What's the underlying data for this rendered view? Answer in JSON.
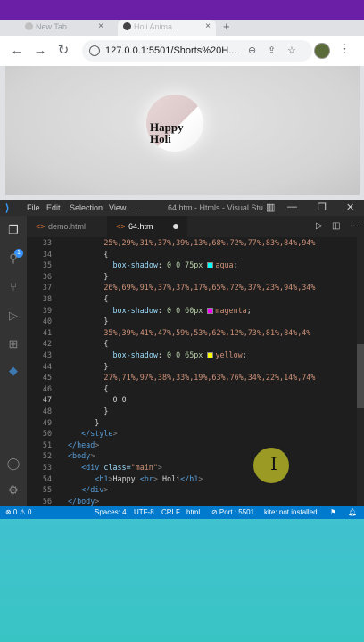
{
  "browser": {
    "tabs": [
      {
        "label": "New Tab"
      },
      {
        "label": "Holi Anima..."
      }
    ],
    "url": "127.0.0.1:5501/Shorts%20H...",
    "page": {
      "heading_line1": "Happy",
      "heading_line2": "Holi"
    }
  },
  "vscode": {
    "menu": [
      "File",
      "Edit",
      "Selection",
      "View",
      "..."
    ],
    "window_title": "64.htm - Htmls - Visual Stu...",
    "tabs": [
      {
        "label": "demo.html"
      },
      {
        "label": "64.htm"
      }
    ],
    "code_lines": [
      {
        "n": "33",
        "text": "25%,29%,31%,37%,39%,13%,68%,72%,77%,83%,84%,94%"
      },
      {
        "n": "34",
        "text": "{"
      },
      {
        "n": "35",
        "prop": "box-shadow",
        "value": "0 0 75px",
        "color_name": "aqua",
        "swatch": "#00ffff"
      },
      {
        "n": "36",
        "text": "}"
      },
      {
        "n": "37",
        "text": "26%,69%,91%,37%,37%,17%,65%,72%,37%,23%,94%,34%"
      },
      {
        "n": "38",
        "text": "{"
      },
      {
        "n": "39",
        "prop": "box-shadow",
        "value": "0 0 60px",
        "color_name": "magenta",
        "swatch": "#ff00ff"
      },
      {
        "n": "40",
        "text": "}"
      },
      {
        "n": "41",
        "text": "35%,39%,41%,47%,59%,53%,62%,12%,73%,81%,84%,4%"
      },
      {
        "n": "42",
        "text": "{"
      },
      {
        "n": "43",
        "prop": "box-shadow",
        "value": "0 0 65px",
        "color_name": "yellow",
        "swatch": "#ffff00"
      },
      {
        "n": "44",
        "text": "}"
      },
      {
        "n": "45",
        "text": "27%,71%,97%,38%,33%,19%,63%,76%,34%,22%,14%,74%"
      },
      {
        "n": "46",
        "text": "{"
      },
      {
        "n": "47",
        "text": "0 0"
      },
      {
        "n": "48",
        "text": "}"
      },
      {
        "n": "49",
        "text": "}"
      },
      {
        "n": "50",
        "text": "</style>"
      },
      {
        "n": "51",
        "text": "</head>"
      },
      {
        "n": "52",
        "text": "<body>"
      },
      {
        "n": "53",
        "text": "<div class=\"main\">"
      },
      {
        "n": "54",
        "text": "<h1>Happy <br> Holi</h1>"
      },
      {
        "n": "55",
        "text": "</div>"
      },
      {
        "n": "56",
        "text": "</body>"
      }
    ],
    "status": {
      "problems": "⊗ 0 ⚠ 0",
      "spaces": "Spaces: 4",
      "encoding": "UTF-8",
      "eol": "CRLF",
      "language": "html",
      "port": "⊘ Port : 5501",
      "extension": "kite: not installed"
    }
  }
}
